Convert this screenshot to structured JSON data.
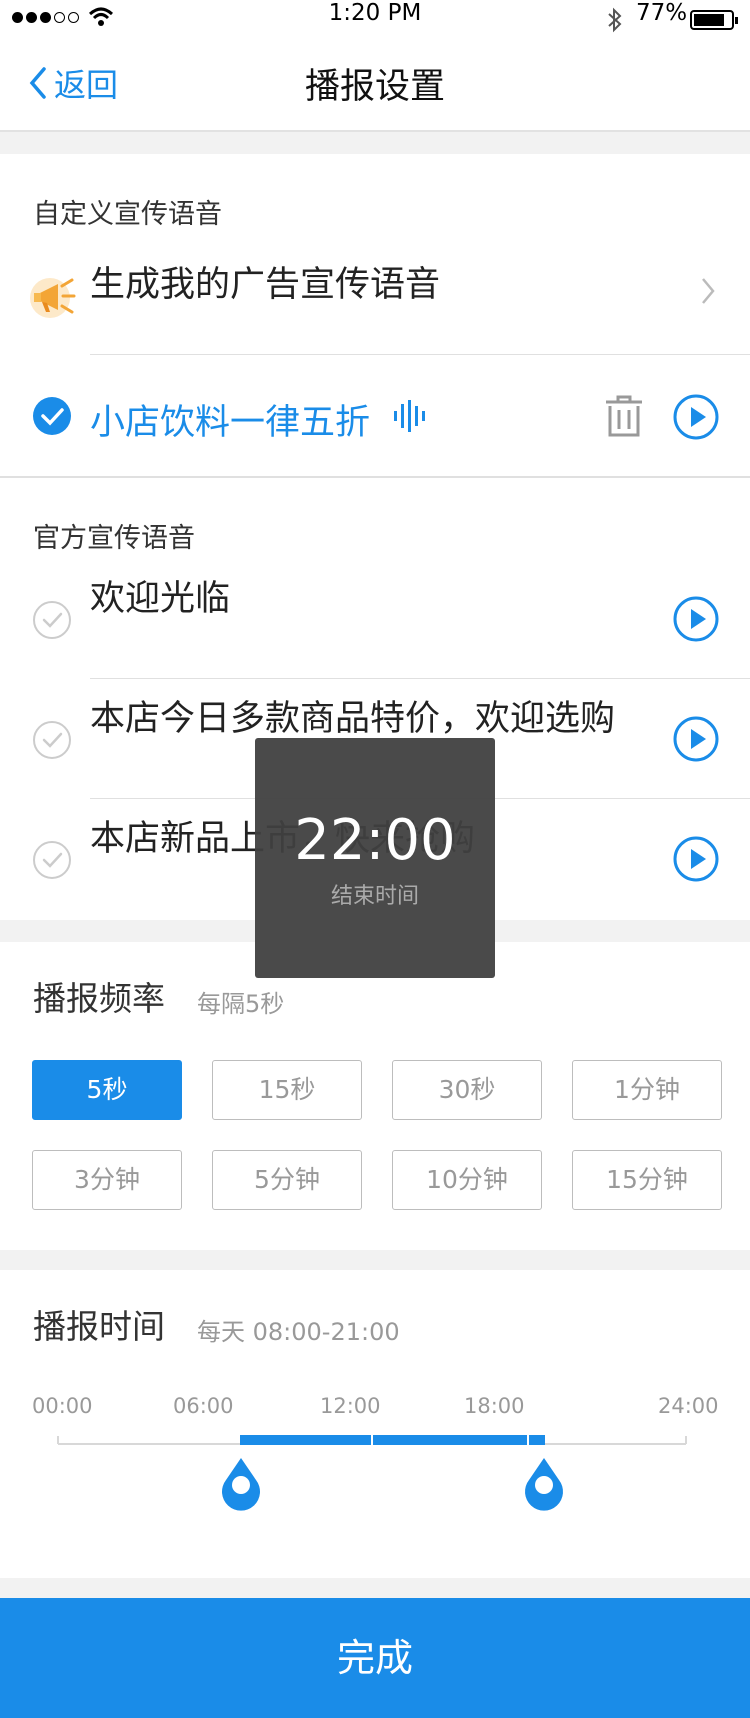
{
  "status_bar": {
    "time": "1:20 PM",
    "battery": "77%"
  },
  "nav": {
    "back_label": "返回",
    "title": "播报设置"
  },
  "custom": {
    "section_title": "自定义宣传语音",
    "generate_label": "生成我的广告宣传语音",
    "item_label": "小店饮料一律五折"
  },
  "official": {
    "section_title": "官方宣传语音",
    "items": [
      {
        "label": "欢迎光临"
      },
      {
        "label": "本店今日多款商品特价，欢迎选购"
      },
      {
        "label": "本店新品上市，快来抢购"
      }
    ]
  },
  "frequency": {
    "title": "播报频率",
    "subtitle": "每隔5秒",
    "options": [
      "5秒",
      "15秒",
      "30秒",
      "1分钟",
      "3分钟",
      "5分钟",
      "10分钟",
      "15分钟"
    ],
    "selected": "5秒"
  },
  "schedule": {
    "title": "播报时间",
    "subtitle": "每天 08:00-21:00",
    "ticks": [
      "00:00",
      "06:00",
      "12:00",
      "18:00",
      "24:00"
    ]
  },
  "toast": {
    "time": "22:00",
    "label": "结束时间"
  },
  "done_label": "完成",
  "colors": {
    "accent": "#1a8ce8"
  }
}
